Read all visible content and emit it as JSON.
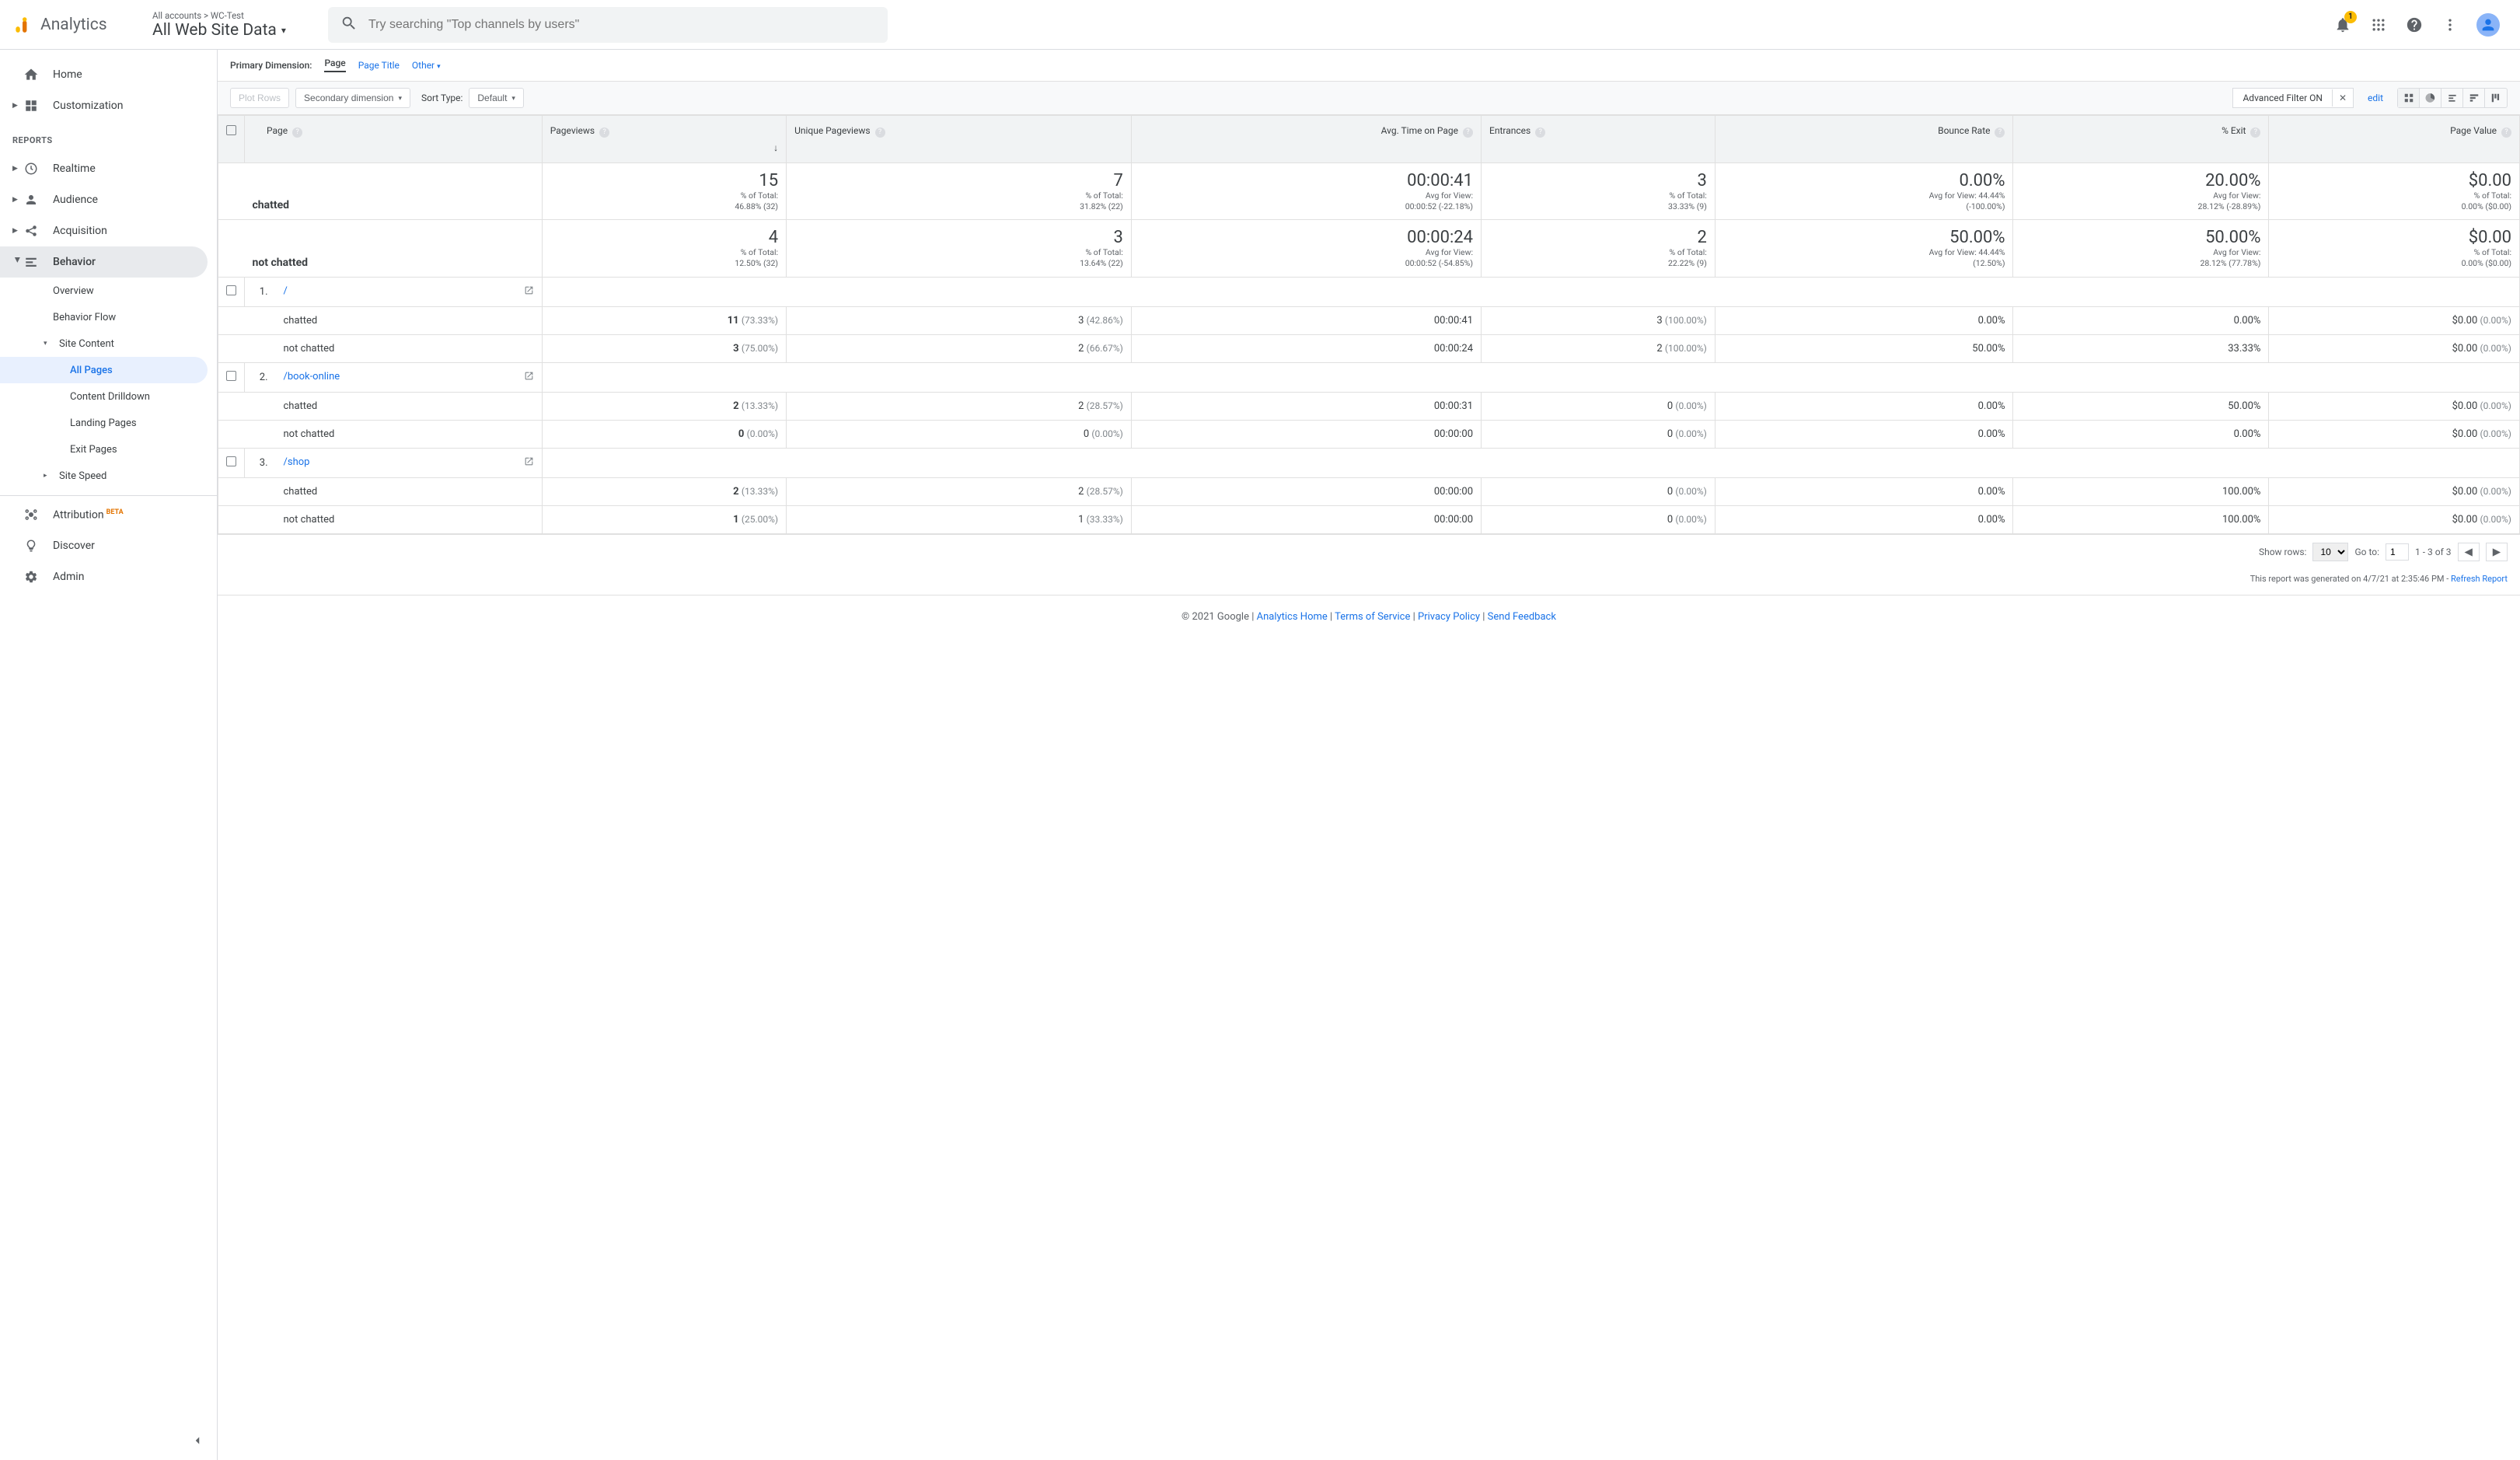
{
  "header": {
    "logo_text": "Analytics",
    "crumb_top": "All accounts > WC-Test",
    "crumb_main": "All Web Site Data",
    "search_placeholder": "Try searching \"Top channels by users\"",
    "notif_count": "1"
  },
  "sidebar": {
    "home": "Home",
    "customization": "Customization",
    "reports_label": "REPORTS",
    "realtime": "Realtime",
    "audience": "Audience",
    "acquisition": "Acquisition",
    "behavior": "Behavior",
    "overview": "Overview",
    "behavior_flow": "Behavior Flow",
    "site_content": "Site Content",
    "all_pages": "All Pages",
    "content_drilldown": "Content Drilldown",
    "landing_pages": "Landing Pages",
    "exit_pages": "Exit Pages",
    "site_speed": "Site Speed",
    "attribution": "Attribution",
    "beta": "BETA",
    "discover": "Discover",
    "admin": "Admin"
  },
  "dimbar": {
    "label": "Primary Dimension:",
    "page": "Page",
    "page_title": "Page Title",
    "other": "Other"
  },
  "toolbar": {
    "plot_rows": "Plot Rows",
    "secondary_dim": "Secondary dimension",
    "sort_type_label": "Sort Type:",
    "sort_type_value": "Default",
    "filter_text": "Advanced Filter ON",
    "edit": "edit"
  },
  "columns": {
    "page": "Page",
    "pageviews": "Pageviews",
    "unique": "Unique Pageviews",
    "avgtime": "Avg. Time on Page",
    "entrances": "Entrances",
    "bounce": "Bounce Rate",
    "exit": "% Exit",
    "value": "Page Value"
  },
  "summary": [
    {
      "label": "chatted",
      "pageviews": {
        "big": "15",
        "sub1": "% of Total:",
        "sub2": "46.88% (32)"
      },
      "unique": {
        "big": "7",
        "sub1": "% of Total:",
        "sub2": "31.82% (22)"
      },
      "avgtime": {
        "big": "00:00:41",
        "sub1": "Avg for View:",
        "sub2": "00:00:52 (-22.18%)"
      },
      "entrances": {
        "big": "3",
        "sub1": "% of Total:",
        "sub2": "33.33% (9)"
      },
      "bounce": {
        "big": "0.00%",
        "sub1": "Avg for View: 44.44%",
        "sub2": "(-100.00%)"
      },
      "exit": {
        "big": "20.00%",
        "sub1": "Avg for View:",
        "sub2": "28.12% (-28.89%)"
      },
      "value": {
        "big": "$0.00",
        "sub1": "% of Total:",
        "sub2": "0.00% ($0.00)"
      }
    },
    {
      "label": "not chatted",
      "pageviews": {
        "big": "4",
        "sub1": "% of Total:",
        "sub2": "12.50% (32)"
      },
      "unique": {
        "big": "3",
        "sub1": "% of Total:",
        "sub2": "13.64% (22)"
      },
      "avgtime": {
        "big": "00:00:24",
        "sub1": "Avg for View:",
        "sub2": "00:00:52 (-54.85%)"
      },
      "entrances": {
        "big": "2",
        "sub1": "% of Total:",
        "sub2": "22.22% (9)"
      },
      "bounce": {
        "big": "50.00%",
        "sub1": "Avg for View: 44.44%",
        "sub2": "(12.50%)"
      },
      "exit": {
        "big": "50.00%",
        "sub1": "Avg for View:",
        "sub2": "28.12% (77.78%)"
      },
      "value": {
        "big": "$0.00",
        "sub1": "% of Total:",
        "sub2": "0.00% ($0.00)"
      }
    }
  ],
  "rows": [
    {
      "n": "1.",
      "page": "/",
      "seg": [
        {
          "label": "chatted",
          "pv": "11",
          "pvp": "(73.33%)",
          "up": "3",
          "upp": "(42.86%)",
          "at": "00:00:41",
          "en": "3",
          "enp": "(100.00%)",
          "br": "0.00%",
          "ex": "0.00%",
          "va": "$0.00",
          "vap": "(0.00%)"
        },
        {
          "label": "not chatted",
          "pv": "3",
          "pvp": "(75.00%)",
          "up": "2",
          "upp": "(66.67%)",
          "at": "00:00:24",
          "en": "2",
          "enp": "(100.00%)",
          "br": "50.00%",
          "ex": "33.33%",
          "va": "$0.00",
          "vap": "(0.00%)"
        }
      ]
    },
    {
      "n": "2.",
      "page": "/book-online",
      "seg": [
        {
          "label": "chatted",
          "pv": "2",
          "pvp": "(13.33%)",
          "up": "2",
          "upp": "(28.57%)",
          "at": "00:00:31",
          "en": "0",
          "enp": "(0.00%)",
          "br": "0.00%",
          "ex": "50.00%",
          "va": "$0.00",
          "vap": "(0.00%)"
        },
        {
          "label": "not chatted",
          "pv": "0",
          "pvp": "(0.00%)",
          "up": "0",
          "upp": "(0.00%)",
          "at": "00:00:00",
          "en": "0",
          "enp": "(0.00%)",
          "br": "0.00%",
          "ex": "0.00%",
          "va": "$0.00",
          "vap": "(0.00%)"
        }
      ]
    },
    {
      "n": "3.",
      "page": "/shop",
      "seg": [
        {
          "label": "chatted",
          "pv": "2",
          "pvp": "(13.33%)",
          "up": "2",
          "upp": "(28.57%)",
          "at": "00:00:00",
          "en": "0",
          "enp": "(0.00%)",
          "br": "0.00%",
          "ex": "100.00%",
          "va": "$0.00",
          "vap": "(0.00%)"
        },
        {
          "label": "not chatted",
          "pv": "1",
          "pvp": "(25.00%)",
          "up": "1",
          "upp": "(33.33%)",
          "at": "00:00:00",
          "en": "0",
          "enp": "(0.00%)",
          "br": "0.00%",
          "ex": "100.00%",
          "va": "$0.00",
          "vap": "(0.00%)"
        }
      ]
    }
  ],
  "pager": {
    "show_rows": "Show rows:",
    "rows_value": "10",
    "goto_label": "Go to:",
    "goto_value": "1",
    "range": "1 - 3 of 3"
  },
  "report_ts": {
    "text": "This report was generated on 4/7/21 at 2:35:46 PM - ",
    "refresh": "Refresh Report"
  },
  "footer": {
    "copyright": "© 2021 Google",
    "home": "Analytics Home",
    "terms": "Terms of Service",
    "privacy": "Privacy Policy",
    "feedback": "Send Feedback"
  }
}
